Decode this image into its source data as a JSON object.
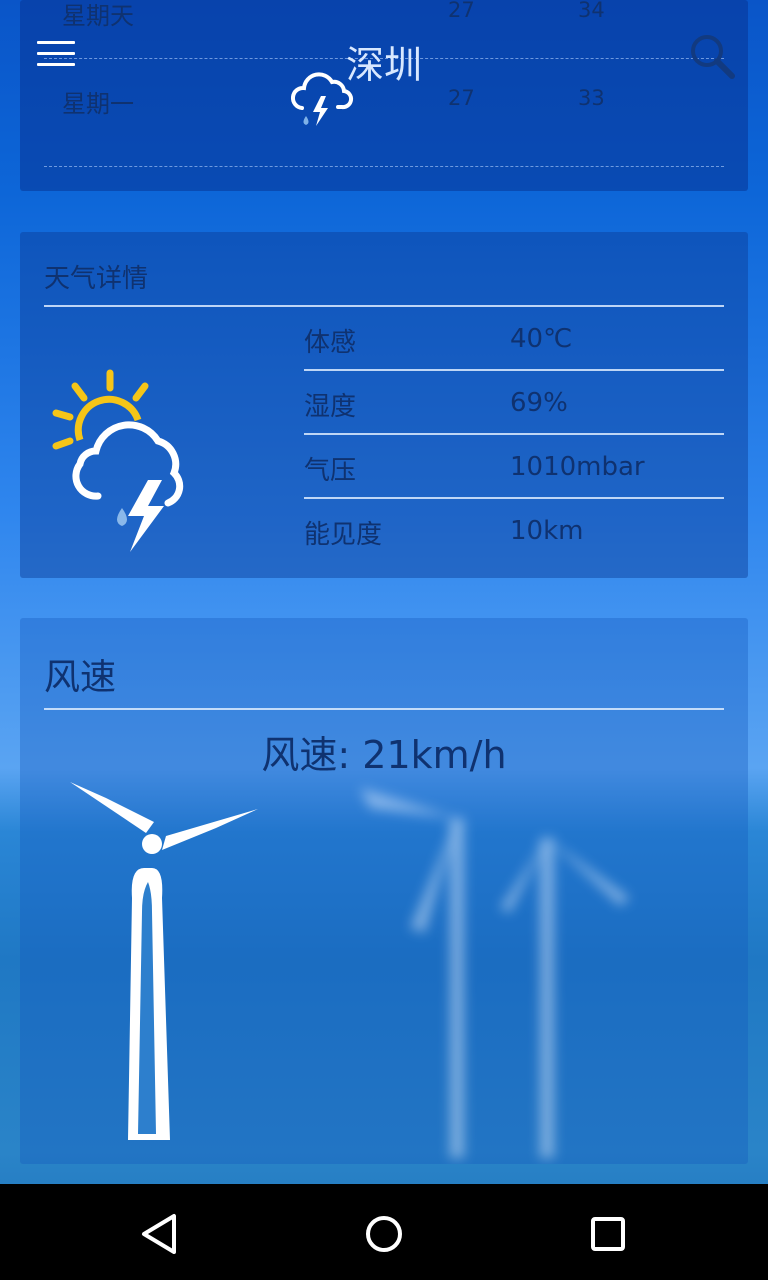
{
  "header": {
    "city": "深圳"
  },
  "forecast": [
    {
      "day": "星期天",
      "icon": "sunny-icon",
      "low": "27",
      "high": "34"
    },
    {
      "day": "星期一",
      "icon": "thunderstorm-icon",
      "low": "27",
      "high": "33"
    }
  ],
  "details": {
    "title": "天气详情",
    "icon": "partly-cloudy-thunderstorm-icon",
    "rows": [
      {
        "label": "体感",
        "value": "40℃"
      },
      {
        "label": "湿度",
        "value": "69%"
      },
      {
        "label": "气压",
        "value": "1010mbar"
      },
      {
        "label": "能见度",
        "value": "10km"
      }
    ]
  },
  "wind": {
    "title": "风速",
    "speed_text": "风速: 21km/h",
    "icon": "wind-turbine-icon"
  },
  "navbar": {
    "back": "back-icon",
    "home": "home-icon",
    "recents": "recents-icon"
  },
  "colors": {
    "text_dark": "#0f3270",
    "icon_white": "#ffffff",
    "sun_yellow": "#f5c518"
  }
}
